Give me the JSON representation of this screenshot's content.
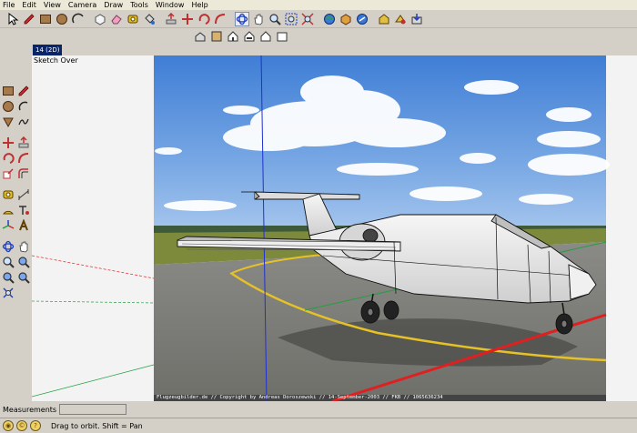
{
  "menu": [
    "File",
    "Edit",
    "View",
    "Camera",
    "Draw",
    "Tools",
    "Window",
    "Help"
  ],
  "scene_tab": "14 (2D)",
  "viewport": {
    "label": "Sketch Over",
    "photo_credit": "Flugzeugbilder.de // Copyright by Andreas Doroszewski // 14-September-2003 // FKB // 1065636234"
  },
  "measurements": {
    "label": "Measurements",
    "value": ""
  },
  "status": {
    "text": "Drag to orbit.  Shift = Pan"
  },
  "colors": {
    "chrome": "#d4d0c8",
    "axis_red": "#e02020",
    "axis_green": "#20a040",
    "axis_blue": "#2030d0",
    "selection_tab": "#0a246a"
  }
}
